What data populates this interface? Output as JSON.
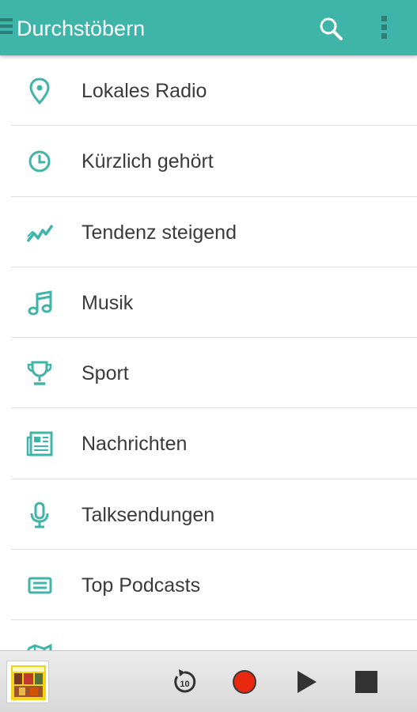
{
  "app_bar": {
    "title": "Durchstöbern",
    "icons": [
      "menu-icon",
      "search-icon",
      "overflow-menu-icon"
    ],
    "color": "#3eb5a8"
  },
  "browse_list": {
    "accent_color": "#3eb5a8",
    "items": [
      {
        "label": "Lokales Radio",
        "icon": "location-pin-icon"
      },
      {
        "label": "Kürzlich gehört",
        "icon": "clock-icon"
      },
      {
        "label": "Tendenz steigend",
        "icon": "trending-icon"
      },
      {
        "label": "Musik",
        "icon": "music-note-icon"
      },
      {
        "label": "Sport",
        "icon": "trophy-icon"
      },
      {
        "label": "Nachrichten",
        "icon": "newspaper-icon"
      },
      {
        "label": "Talksendungen",
        "icon": "microphone-icon"
      },
      {
        "label": "Top Podcasts",
        "icon": "podcast-icon"
      },
      {
        "label": "",
        "icon": "map-icon"
      }
    ]
  },
  "player": {
    "replay_seconds": "10",
    "icons": [
      "album-art",
      "replay-10-icon",
      "record-icon",
      "play-icon",
      "stop-icon"
    ],
    "record_color": "#e8290f"
  }
}
